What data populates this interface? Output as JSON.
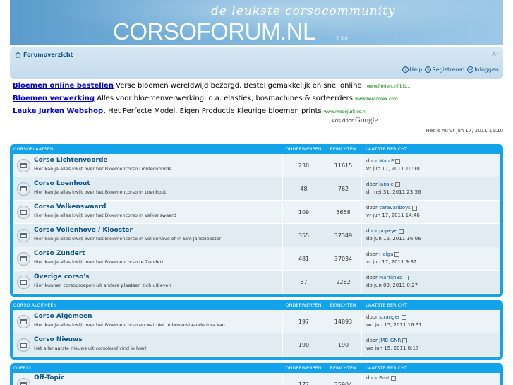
{
  "banner": {
    "tagline": "de leukste corsocommunity",
    "logo_corso": "CORSO",
    "logo_forum": "FORUM.NL",
    "version": "V. 3.0"
  },
  "nav": {
    "home": "Forumoverzicht",
    "font_size": "−A⁺",
    "help": "Help",
    "register": "Registreren",
    "login": "Inloggen"
  },
  "ads": [
    {
      "link": "Bloemen online bestellen",
      "text": " Verse bloemen wereldwijd bezorgd. Bestel gemakkelijk en snel online!",
      "url": "www.florient.nl/blo..."
    },
    {
      "link": "Bloemen verwerking",
      "text": " Alles voor bloemenverwerking: o.a. elastiek, bosmachines & sorteerders",
      "url": "www.bercomex.com"
    },
    {
      "link": "Leuke Jurken Webshop.",
      "text": " Het Perfecte Model. Eigen Productie Kleurige bloemen prints",
      "url": "www.modojurkjes.nl"
    }
  ],
  "ads_by": "Ads door",
  "ads_google": "Google",
  "current_time": "Het is nu vr jun 17, 2011 15:10",
  "columns": {
    "topics": "ONDERWERPEN",
    "posts": "BERICHTEN",
    "last": "LAATSTE BERICHT"
  },
  "categories": [
    {
      "name": "CORSOPLAATSEN",
      "forums": [
        {
          "title": "Corso Lichtenvoorde",
          "desc": "Hier kan je alles kwijt over het Bloemencorso Lichtenvoorde",
          "topics": "230",
          "posts": "11615",
          "by": "MarcP",
          "date": "vr jun 17, 2011 10:10"
        },
        {
          "title": "Corso Loenhout",
          "desc": "Hier kan je alles kwijt over het Bloemencorso in Loenhout",
          "topics": "48",
          "posts": "762",
          "by": "lansie",
          "date": "di mei 31, 2011 23:56"
        },
        {
          "title": "Corso Valkenswaard",
          "desc": "Hier kan je alles kwijt over het Bloemencorso in Valkenswaard",
          "topics": "109",
          "posts": "5658",
          "by": "caravanboys",
          "date": "vr jun 17, 2011 14:46"
        },
        {
          "title": "Corso Vollenhove / Klooster",
          "desc": "Hier kan je alles kwijt over het Bloemencorso in Vollenhove of in Sint Jansklooster",
          "topics": "355",
          "posts": "37349",
          "by": "popeye",
          "date": "do jun 16, 2011 16:06"
        },
        {
          "title": "Corso Zundert",
          "desc": "Hier kan je alles kwijt over het Bloemencorso te Zundert",
          "topics": "481",
          "posts": "37034",
          "by": "Helga",
          "date": "vr jun 17, 2011 9:32"
        },
        {
          "title": "Overige corso's",
          "desc": "Hier kunnen corsogroepen uit andere plaatsen zich uitleven",
          "topics": "57",
          "posts": "2262",
          "by": "Martijn85",
          "date": "do jun 09, 2011 0:27"
        }
      ]
    },
    {
      "name": "CORSO ALGEMEEN",
      "forums": [
        {
          "title": "Corso Algemeen",
          "desc": "Hier kan je alles kwijt over het Bloemencorso en wat niet in bovenstaande fora kan.",
          "topics": "197",
          "posts": "14893",
          "by": "stranger",
          "date": "wo jun 15, 2011 16:31"
        },
        {
          "title": "Corso Nieuws",
          "desc": "Het allerlaatste nieuws uit corsoland vind je hier!",
          "topics": "190",
          "posts": "190",
          "by": "JMB-GNR",
          "date": "wo jun 15, 2011 8:17"
        }
      ]
    },
    {
      "name": "OVERIG",
      "forums": [
        {
          "title": "Off-Topic",
          "desc": "",
          "topics": "177",
          "posts": "35904",
          "by": "Bart",
          "date": ""
        }
      ]
    }
  ],
  "by_prefix": "door"
}
